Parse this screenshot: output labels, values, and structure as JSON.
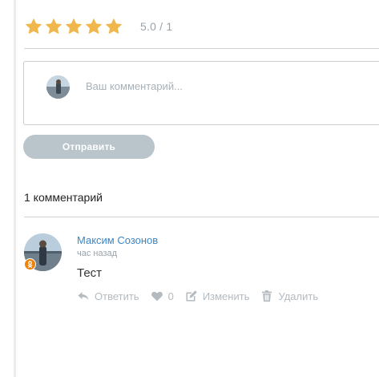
{
  "rating": {
    "stars_filled": 5,
    "stars_total": 5,
    "text": "5.0 / 1",
    "star_color": "#f0b84c"
  },
  "form": {
    "placeholder": "Ваш комментарий...",
    "submit_label": "Отправить"
  },
  "comments_count_label": "1 комментарий",
  "comment": {
    "author": "Максим Созонов",
    "time": "час назад",
    "text": "Тест",
    "actions": {
      "reply": "Ответить",
      "likes": "0",
      "edit": "Изменить",
      "delete": "Удалить"
    },
    "author_color": "#3a86c8"
  },
  "icons": [
    "star-icon",
    "reply-icon",
    "heart-icon",
    "edit-icon",
    "trash-icon",
    "odnoklassniki-icon"
  ]
}
